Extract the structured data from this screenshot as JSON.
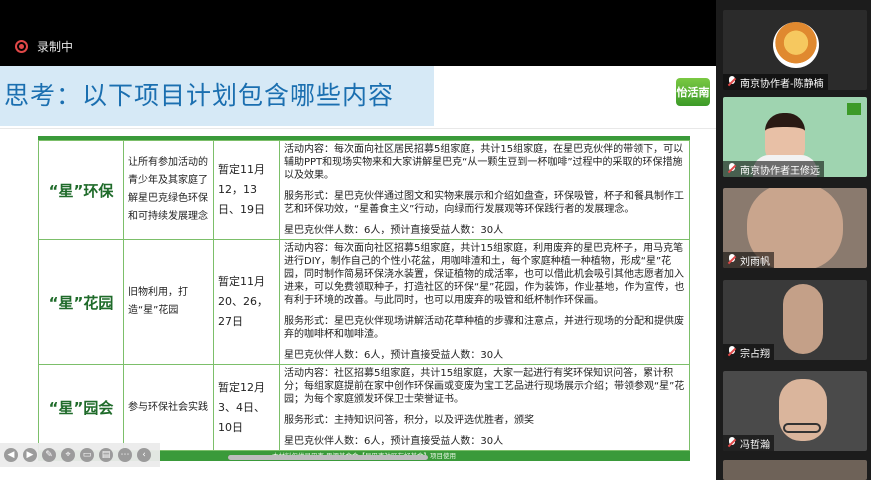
{
  "recording": {
    "label": "录制中"
  },
  "slide": {
    "title": "思考：以下项目计划包含哪些内容",
    "logo_text": "怡活南",
    "footer": "本材料仅供星巴克·思源基金会【星巴克社区友好基金】项目使用",
    "rows": [
      {
        "name": "“星”环保",
        "goal": "让所有参加活动的青少年及其家庭了解星巴克绿色环保和可持续发展理念",
        "time": "暂定11月12，13日、19日",
        "detail": [
          "活动内容：每次面向社区居民招募5组家庭，共计15组家庭，在星巴克伙伴的带领下，可以辅助PPT和现场实物来和大家讲解星巴克“从一颗生豆到一杯咖啡”过程中的采取的环保措施以及效果。",
          "服务形式：星巴克伙伴通过图文和实物来展示和介绍如盘查，环保吸管，杯子和餐具制作工艺和环保功效，“星善食主义”行动，向绿而行发展观等环保践行者的发展理念。",
          "星巴克伙伴人数：6人，预计直接受益人数：30人"
        ]
      },
      {
        "name": "“星”花园",
        "goal": "旧物利用，打造“星”花园",
        "time": "暂定11月20、26，27日",
        "detail": [
          "活动内容：每次面向社区招募5组家庭，共计15组家庭，利用废弃的星巴克杯子，用马克笔进行DIY，制作自己的个性小花盆，用咖啡渣和土，每个家庭种植一种植物，形成“星”花园，同时制作简易环保浇水装置，保证植物的成活率，也可以借此机会吸引其他志愿者加入进来，可以免费领取种子，打造社区的环保“星”花园，作为装饰，作业基地，作为宣传，也有利于环境的改善。与此同时，也可以用废弃的吸管和纸杯制作环保画。",
          "服务形式：星巴克伙伴现场讲解活动花草种植的步骤和注意点，并进行现场的分配和提供废弃的咖啡杯和咖啡渣。",
          "星巴克伙伴人数：6人，预计直接受益人数：30人"
        ]
      },
      {
        "name": "“星”园会",
        "goal": "参与环保社会实践",
        "time": "暂定12月3、4日、10日",
        "detail": [
          "活动内容：社区招募5组家庭，共计15组家庭，大家一起进行有奖环保知识问答，累计积分；每组家庭提前在家中创作环保画或变废为宝工艺品进行现场展示介绍；带领参观“星”花园；为每个家庭颁发环保卫士荣誉证书。",
          "服务形式：主持知识问答，积分，以及评选优胜者，颁奖",
          "星巴克伙伴人数：6人，预计直接受益人数：30人"
        ]
      }
    ]
  },
  "toolbar": {
    "icons": [
      "prev-icon",
      "next-icon",
      "pen-icon",
      "pointer-icon",
      "screen-icon",
      "chat-icon",
      "more-icon",
      "collapse-icon"
    ]
  },
  "participants": [
    {
      "name": "南京协作者-陈静楠",
      "muted": true
    },
    {
      "name": "南京协作者王修远",
      "muted": true
    },
    {
      "name": "刘雨帆",
      "muted": true
    },
    {
      "name": "宗占翔",
      "muted": true
    },
    {
      "name": "冯哲瀚",
      "muted": true
    }
  ],
  "colors": {
    "accent_green": "#3a9a3a",
    "title_blue": "#1b6fb0",
    "mute_red": "#e04848"
  }
}
